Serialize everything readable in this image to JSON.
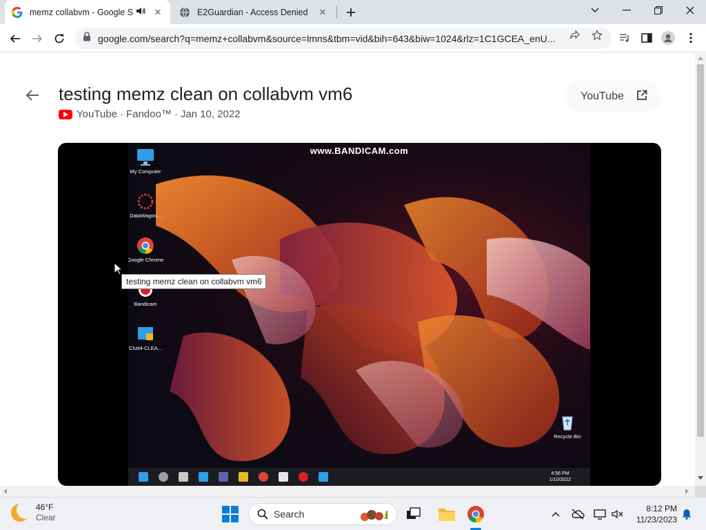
{
  "browser": {
    "tabs": [
      {
        "title": "memz collabvm - Google Se",
        "active": true
      },
      {
        "title": "E2Guardian - Access Denied",
        "active": false
      }
    ],
    "url": "google.com/search?q=memz+collabvm&source=lmns&tbm=vid&bih=643&biw=1024&rlz=1C1GCEA_enU..."
  },
  "video": {
    "title": "testing memz clean on collabvm vm6",
    "source": "YouTube",
    "channel": "Fandoo™",
    "date": "Jan 10, 2022",
    "separator": "·",
    "open_button": "YouTube",
    "tooltip": "testing memz clean on collabvm vm6",
    "watermark": "www.BANDICAM.com",
    "desktop_icons": [
      {
        "label": "My Computer"
      },
      {
        "label": "DataWagon..."
      },
      {
        "label": "Google Chrome"
      },
      {
        "label": "Bandicam"
      },
      {
        "label": "Clutt4-CLEA..."
      },
      {
        "label": "Recycle Bin"
      }
    ],
    "vm_time": "4:56 PM",
    "vm_date": "1/10/2022"
  },
  "taskbar": {
    "weather_temp": "46°F",
    "weather_desc": "Clear",
    "search_label": "Search",
    "time": "8:12 PM",
    "date": "11/23/2023"
  },
  "colors": {
    "youtube_red": "#ff0000",
    "windows_blue": "#0a7cd9",
    "tab_strip": "#dee1e6"
  }
}
